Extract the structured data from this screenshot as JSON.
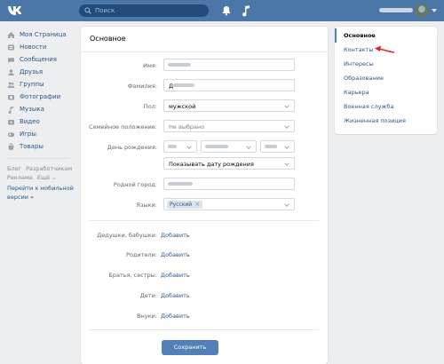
{
  "topbar": {
    "search_placeholder": "Поиск",
    "accent": "#4a76a8"
  },
  "leftnav": {
    "items": [
      {
        "label": "Моя Страница",
        "icon": "home-icon"
      },
      {
        "label": "Новости",
        "icon": "news-icon"
      },
      {
        "label": "Сообщения",
        "icon": "messages-icon"
      },
      {
        "label": "Друзья",
        "icon": "friends-icon"
      },
      {
        "label": "Группы",
        "icon": "groups-icon"
      },
      {
        "label": "Фотографии",
        "icon": "photos-icon"
      },
      {
        "label": "Музыка",
        "icon": "music-icon"
      },
      {
        "label": "Видео",
        "icon": "video-icon"
      },
      {
        "label": "Игры",
        "icon": "games-icon"
      },
      {
        "label": "Товары",
        "icon": "market-icon"
      }
    ],
    "footer": {
      "blog": "Блог",
      "developers": "Разработчикам",
      "ads": "Реклама",
      "more": "Ещё ⌄",
      "mobile": "Перейти к мобильной версии »"
    }
  },
  "form": {
    "title": "Основное",
    "first_name_label": "Имя:",
    "last_name_label": "Фамилия:",
    "last_name_value": "Д",
    "gender_label": "Пол:",
    "gender_value": "мужской",
    "marital_label": "Семейное положение:",
    "marital_value": "Не выбрано",
    "birthday_label": "День рождения:",
    "birthday_visibility": "Показывать дату рождения",
    "hometown_label": "Родной город:",
    "languages_label": "Языки:",
    "language_tag": "Русский",
    "grandparents_label": "Дедушки, бабушки:",
    "parents_label": "Родители:",
    "siblings_label": "Братья, сестры:",
    "children_label": "Дети:",
    "grandchildren_label": "Внуки:",
    "add_label": "Добавить",
    "save_label": "Сохранить"
  },
  "rightmenu": {
    "items": [
      {
        "label": "Основное",
        "active": true
      },
      {
        "label": "Контакты",
        "active": false
      },
      {
        "label": "Интересы",
        "active": false
      },
      {
        "label": "Образование",
        "active": false
      },
      {
        "label": "Карьера",
        "active": false
      },
      {
        "label": "Военная служба",
        "active": false
      },
      {
        "label": "Жизненная позиция",
        "active": false
      }
    ]
  },
  "colors": {
    "link": "#2a5885",
    "button": "#5181b8",
    "pointer_arrow": "#e02424"
  }
}
